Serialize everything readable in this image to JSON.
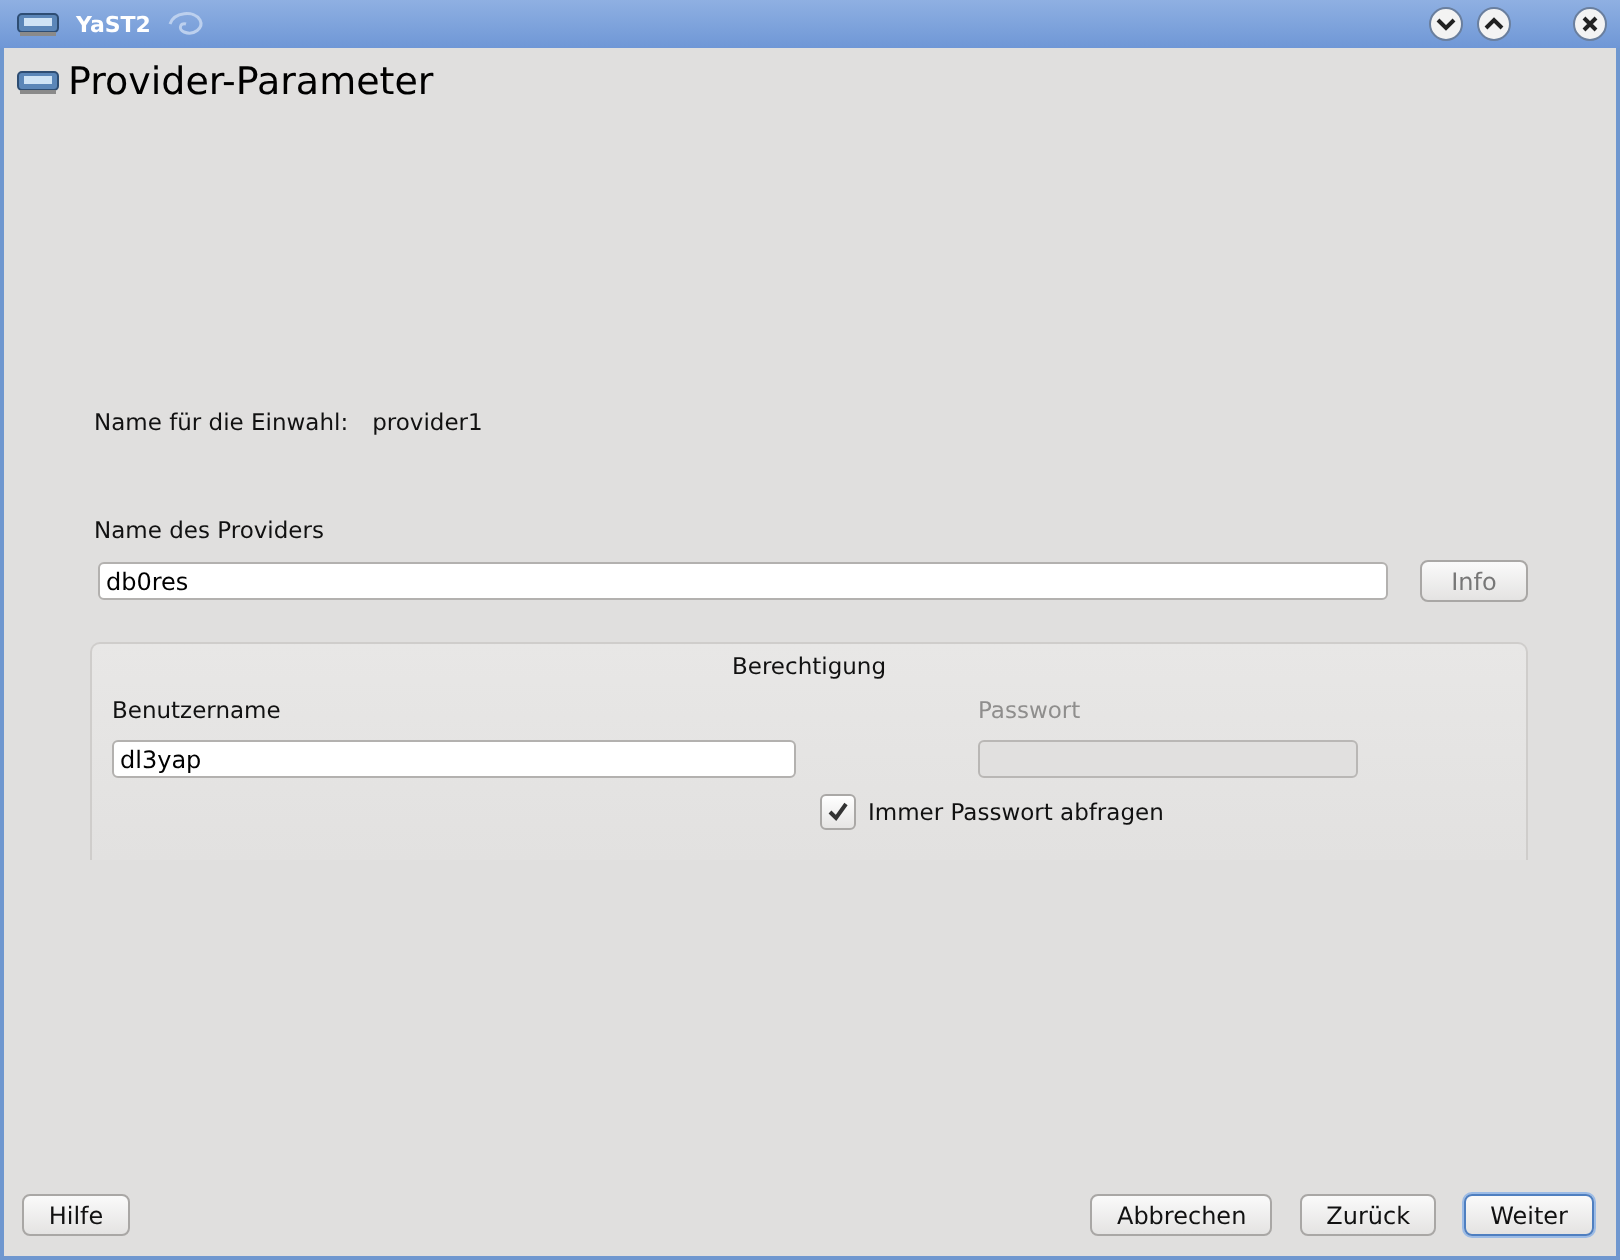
{
  "window": {
    "title": "YaST2"
  },
  "heading": "Provider-Parameter",
  "dial_name": {
    "label": "Name für die Einwahl:",
    "value": "provider1"
  },
  "provider": {
    "label": "Name des Providers",
    "value": "db0res",
    "info_button": "Info"
  },
  "auth": {
    "title": "Berechtigung",
    "username": {
      "label": "Benutzername",
      "value": "dl3yap"
    },
    "password": {
      "label": "Passwort",
      "disabled": true
    },
    "always_ask": {
      "label": "Immer Passwort abfragen",
      "checked": true
    }
  },
  "buttons": [
    {
      "label": "Hilfe",
      "kind": "help",
      "default": false
    },
    {
      "label": "Abbrechen",
      "kind": "nav",
      "default": false
    },
    {
      "label": "Zurück",
      "kind": "nav",
      "default": false
    },
    {
      "label": "Weiter",
      "kind": "nav",
      "default": true
    }
  ]
}
